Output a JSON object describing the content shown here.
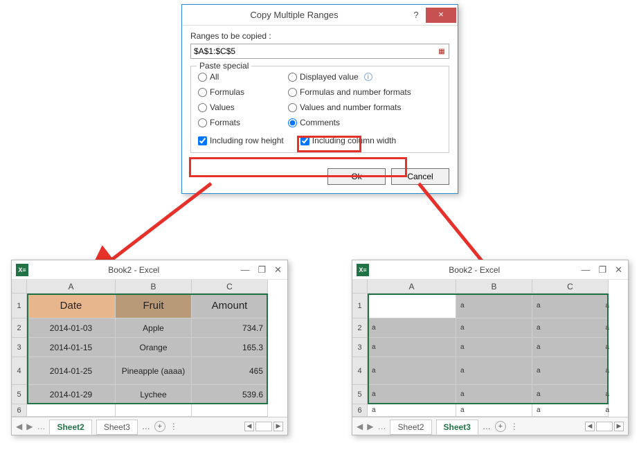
{
  "dialog": {
    "title": "Copy Multiple Ranges",
    "help_char": "?",
    "close_char": "×",
    "ranges_label": "Ranges to be copied :",
    "range_value": "$A$1:$C$5",
    "paste_special_legend": "Paste special",
    "radios": {
      "all": "All",
      "displayed_value": "Displayed value",
      "formulas": "Formulas",
      "formulas_number_formats": "Formulas and number formats",
      "values": "Values",
      "values_number_formats": "Values and number formats",
      "formats": "Formats",
      "comments": "Comments"
    },
    "checks": {
      "including_row_height": "Including row height",
      "including_column_width": "Including column width"
    },
    "ok": "Ok",
    "cancel": "Cancel"
  },
  "excel_left": {
    "title": "Book2 - Excel",
    "min": "—",
    "restore": "❐",
    "close": "✕",
    "col_headers": [
      "A",
      "B",
      "C"
    ],
    "row_labels": [
      "1",
      "2",
      "3",
      "4",
      "5",
      "6"
    ],
    "header_row": [
      "Date",
      "Fruit",
      "Amount"
    ],
    "data": [
      [
        "2014-01-03",
        "Apple",
        "734.7"
      ],
      [
        "2014-01-15",
        "Orange",
        "165.3"
      ],
      [
        "2014-01-25",
        "Pineapple (aaaa)",
        "465"
      ],
      [
        "2014-01-29",
        "Lychee",
        "539.6"
      ]
    ],
    "tabs": {
      "left": "Sheet2",
      "right": "Sheet3",
      "active": "left",
      "ellipsis": "…",
      "plus": "+"
    }
  },
  "excel_right": {
    "title": "Book2 - Excel",
    "min": "—",
    "restore": "❐",
    "close": "✕",
    "col_headers": [
      "A",
      "B",
      "C"
    ],
    "row_labels": [
      "1",
      "2",
      "3",
      "4",
      "5",
      "6"
    ],
    "a": "a",
    "tabs": {
      "left": "Sheet2",
      "right": "Sheet3",
      "active": "right",
      "ellipsis": "…",
      "plus": "+"
    }
  }
}
